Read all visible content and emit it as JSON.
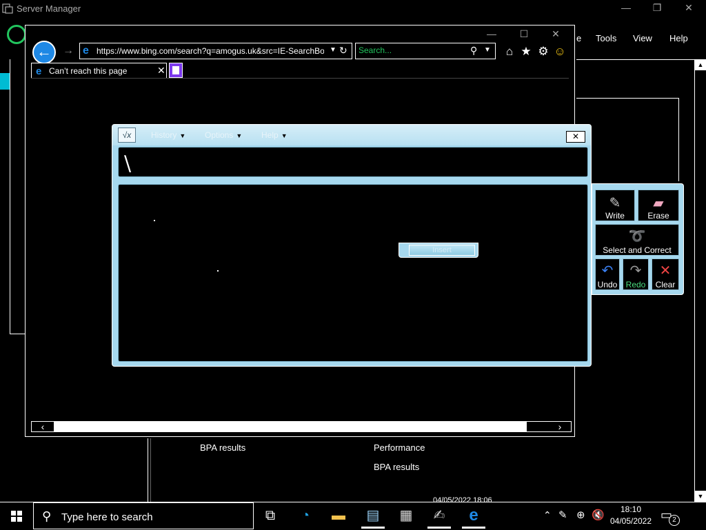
{
  "server_manager": {
    "title": "Server Manager",
    "menus": [
      "Tools",
      "View",
      "Help"
    ],
    "menu_partial": "e",
    "tiles": {
      "left_bpa": "BPA results",
      "right_performance": "Performance",
      "right_bpa": "BPA results"
    },
    "timestamp": "04/05/2022 18:06",
    "caption": {
      "minimize": "—",
      "restore": "❐",
      "close": "✕"
    }
  },
  "browser": {
    "url": "https://www.bing.com/search?q=amogus.uk&src=IE-SearchBox",
    "search_placeholder": "Search...",
    "tab_title": "Can’t reach this page",
    "caption": {
      "minimize": "—",
      "maximize": "☐",
      "close": "✕"
    },
    "icons": [
      "home-icon",
      "favorites-star-icon",
      "settings-gear-icon",
      "feedback-smiley-icon"
    ]
  },
  "math_input_panel": {
    "menus": [
      "History",
      "Options",
      "Help"
    ],
    "preview_text": "\\",
    "insert_label": "Insert",
    "tools": {
      "write": "Write",
      "erase": "Erase",
      "select_correct": "Select and Correct",
      "undo": "Undo",
      "redo": "Redo",
      "clear": "Clear"
    },
    "colors": {
      "frame": "#a6d8ee",
      "redo_accent": "#4ade80"
    }
  },
  "taskbar": {
    "search_text": "Type here to search",
    "time": "18:10",
    "date": "04/05/2022",
    "notification_count": "2",
    "apps": [
      "task-view-icon",
      "edge-icon",
      "file-explorer-icon",
      "server-manager-icon",
      "calculator-icon",
      "math-input-icon",
      "internet-explorer-icon"
    ]
  }
}
